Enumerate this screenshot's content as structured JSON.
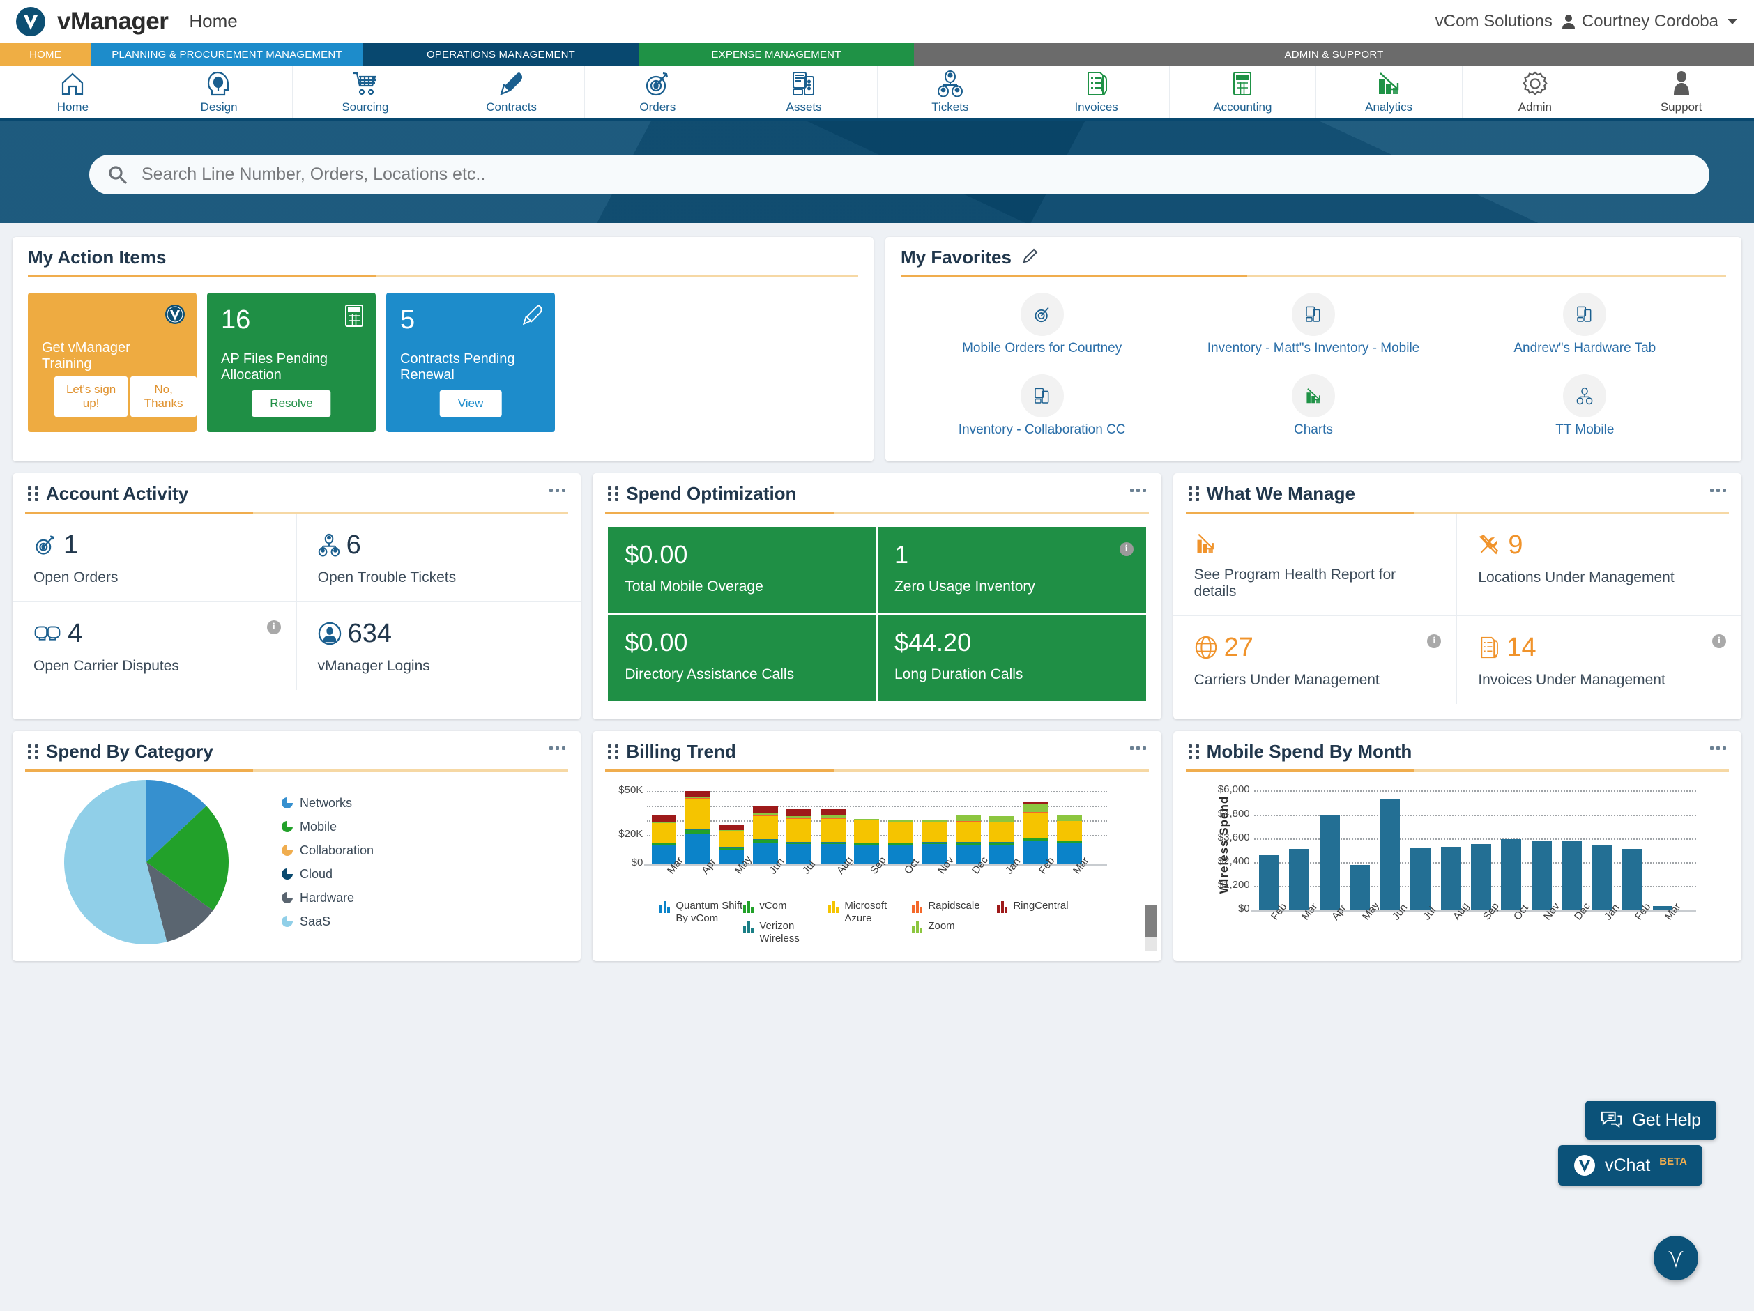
{
  "topbar": {
    "brand": "vManager",
    "page": "Home",
    "org": "vCom Solutions",
    "user": "Courtney Cordoba"
  },
  "nav_tabs": [
    {
      "label": "HOME",
      "color": "#efae44",
      "key": "home"
    },
    {
      "label": "PLANNING & PROCUREMENT MANAGEMENT",
      "color": "#1d8ccb",
      "key": "planning"
    },
    {
      "label": "OPERATIONS MANAGEMENT",
      "color": "#08486f",
      "key": "operations"
    },
    {
      "label": "EXPENSE MANAGEMENT",
      "color": "#1f9246",
      "key": "expense"
    },
    {
      "label": "ADMIN & SUPPORT",
      "color": "#6b6b6b",
      "key": "admin"
    }
  ],
  "icon_nav": [
    {
      "label": "Home",
      "icon": "home-icon"
    },
    {
      "label": "Design",
      "icon": "design-head-bulb-icon"
    },
    {
      "label": "Sourcing",
      "icon": "shopping-cart-icon"
    },
    {
      "label": "Contracts",
      "icon": "fountain-pen-icon"
    },
    {
      "label": "Orders",
      "icon": "target-dart-icon"
    },
    {
      "label": "Assets",
      "icon": "devices-icon"
    },
    {
      "label": "Tickets",
      "icon": "people-group-icon"
    },
    {
      "label": "Invoices",
      "icon": "invoice-pen-icon"
    },
    {
      "label": "Accounting",
      "icon": "calculator-icon"
    },
    {
      "label": "Analytics",
      "icon": "bar-chart-arrow-icon"
    },
    {
      "label": "Admin",
      "icon": "gear-icon"
    },
    {
      "label": "Support",
      "icon": "person-icon"
    }
  ],
  "search": {
    "placeholder": "Search Line Number, Orders, Locations etc..",
    "value": ""
  },
  "action_items": {
    "title": "My Action Items",
    "tiles": [
      {
        "number": "",
        "caption": "Get vManager Training",
        "color": "#eeab41",
        "icon": "vmanager-seal-icon",
        "buttons": [
          "Let's sign up!",
          "No, Thanks"
        ]
      },
      {
        "number": "16",
        "caption": "AP Files Pending Allocation",
        "color": "#1f8f45",
        "icon": "calculator-icon",
        "buttons": [
          "Resolve"
        ]
      },
      {
        "number": "5",
        "caption": "Contracts Pending Renewal",
        "color": "#1d8ccb",
        "icon": "fountain-pen-icon",
        "buttons": [
          "View"
        ]
      }
    ]
  },
  "favorites": {
    "title": "My Favorites",
    "edit_icon": "pencil-icon",
    "items": [
      {
        "label": "Mobile Orders for Courtney",
        "icon": "target-dart-icon"
      },
      {
        "label": "Inventory - Matt\"s Inventory - Mobile",
        "icon": "devices-icon"
      },
      {
        "label": "Andrew\"s Hardware Tab",
        "icon": "devices-icon"
      },
      {
        "label": "Inventory - Collaboration CC",
        "icon": "devices-icon"
      },
      {
        "label": "Charts",
        "icon": "bar-chart-arrow-icon"
      },
      {
        "label": "TT Mobile",
        "icon": "people-group-icon"
      }
    ]
  },
  "account_activity": {
    "title": "Account Activity",
    "stats": [
      {
        "value": "1",
        "label": "Open Orders",
        "icon": "target-dart-icon",
        "info": false
      },
      {
        "value": "6",
        "label": "Open Trouble Tickets",
        "icon": "people-group-icon",
        "info": false
      },
      {
        "value": "4",
        "label": "Open Carrier Disputes",
        "icon": "boxing-gloves-icon",
        "info": true
      },
      {
        "value": "634",
        "label": "vManager Logins",
        "icon": "user-circle-icon",
        "info": false
      }
    ]
  },
  "spend_optimization": {
    "title": "Spend Optimization",
    "cells": [
      {
        "value": "$0.00",
        "label": "Total Mobile Overage",
        "info": false
      },
      {
        "value": "1",
        "label": "Zero Usage Inventory",
        "info": true
      },
      {
        "value": "$0.00",
        "label": "Directory Assistance Calls",
        "info": false
      },
      {
        "value": "$44.20",
        "label": "Long Duration Calls",
        "info": false
      }
    ]
  },
  "what_we_manage": {
    "title": "What We Manage",
    "cells": [
      {
        "value": "",
        "label": "See Program Health Report for details",
        "icon": "bar-chart-arrow-icon",
        "info": false
      },
      {
        "value": "9",
        "label": "Locations Under Management",
        "icon": "tools-icon",
        "info": false
      },
      {
        "value": "27",
        "label": "Carriers Under Management",
        "icon": "globe-icon",
        "info": true
      },
      {
        "value": "14",
        "label": "Invoices Under Management",
        "icon": "invoice-pen-icon",
        "info": true
      }
    ]
  },
  "spend_by_category": {
    "title": "Spend By Category"
  },
  "billing_trend": {
    "title": "Billing Trend"
  },
  "mobile_spend": {
    "title": "Mobile Spend By Month"
  },
  "chat": {
    "get_help": "Get Help",
    "vchat": "vChat",
    "beta": "BETA",
    "fab_icon": "vmanager-v-icon"
  },
  "chart_data": [
    {
      "id": "spend_by_category",
      "type": "pie",
      "title": "Spend By Category",
      "legend_position": "right",
      "categories": [
        "Networks",
        "Mobile",
        "Collaboration",
        "Cloud",
        "Hardware",
        "SaaS"
      ],
      "colors": [
        "#3690cf",
        "#22a12a",
        "#f0ad4e",
        "#0b4a6f",
        "#5a6570",
        "#90cfe8"
      ],
      "values": [
        13,
        22,
        0,
        0,
        11,
        54
      ],
      "unit": "percent"
    },
    {
      "id": "billing_trend",
      "type": "bar",
      "stacked": true,
      "title": "Billing Trend",
      "xlabel": "",
      "ylabel": "",
      "ylim": [
        0,
        57000
      ],
      "yticks": [
        0,
        20000,
        50000
      ],
      "ytick_labels": [
        "$0",
        "$20K",
        "$50K"
      ],
      "grid": true,
      "legend_position": "bottom",
      "categories": [
        "Mar",
        "Apr",
        "May",
        "Jun",
        "Jul",
        "Aug",
        "Sep",
        "Oct",
        "Nov",
        "Dec",
        "Jan",
        "Feb",
        "Mar"
      ],
      "series": [
        {
          "name": "Quantum Shift By vCom",
          "color": "#0b83c9",
          "values": [
            12500,
            20800,
            9600,
            14200,
            13300,
            13400,
            13100,
            13200,
            13400,
            13000,
            13100,
            15500,
            14600
          ]
        },
        {
          "name": "vCom",
          "color": "#22a12a",
          "values": [
            1600,
            2400,
            1500,
            2300,
            1300,
            1300,
            900,
            900,
            1100,
            1500,
            1400,
            2200,
            900
          ]
        },
        {
          "name": "Verizon Wireless",
          "color": "#1b7f86",
          "values": [
            300,
            300,
            300,
            500,
            300,
            300,
            300,
            300,
            300,
            400,
            400,
            400,
            300
          ]
        },
        {
          "name": "Microsoft Azure",
          "color": "#f5c400",
          "values": [
            13500,
            21400,
            11100,
            16100,
            15900,
            16100,
            15500,
            13900,
            13700,
            14200,
            14000,
            17100,
            13700
          ]
        },
        {
          "name": "Rapidscale",
          "color": "#f4682a",
          "values": [
            200,
            300,
            200,
            700,
            900,
            1000,
            200,
            400,
            400,
            200,
            200,
            800,
            200
          ]
        },
        {
          "name": "Zoom",
          "color": "#8cc63f",
          "values": [
            300,
            1400,
            300,
            1300,
            1400,
            1300,
            1100,
            1200,
            1100,
            4000,
            3700,
            5600,
            3800
          ]
        },
        {
          "name": "RingCentral",
          "color": "#9e1a1a",
          "values": [
            4800,
            3900,
            3600,
            4700,
            4800,
            4400,
            0,
            0,
            0,
            0,
            0,
            700,
            0
          ]
        }
      ]
    },
    {
      "id": "mobile_spend_by_month",
      "type": "bar",
      "stacked": false,
      "title": "Mobile Spend By Month",
      "xlabel": "",
      "ylabel": "Wireless Spend",
      "ylim": [
        0,
        6400
      ],
      "yticks": [
        0,
        1200,
        2400,
        3600,
        4800,
        6000
      ],
      "ytick_labels": [
        "$0",
        "$1,200",
        "$2,400",
        "$3,600",
        "$4,800",
        "$6,000"
      ],
      "grid": true,
      "color": "#236f94",
      "categories": [
        "Feb",
        "Mar",
        "Apr",
        "May",
        "Jun",
        "Jul",
        "Aug",
        "Sep",
        "Oct",
        "Nov",
        "Dec",
        "Jan",
        "Feb",
        "Mar"
      ],
      "values": [
        2750,
        3050,
        4780,
        2250,
        5550,
        3100,
        3170,
        3290,
        3540,
        3460,
        3470,
        3230,
        3050,
        180
      ]
    }
  ]
}
